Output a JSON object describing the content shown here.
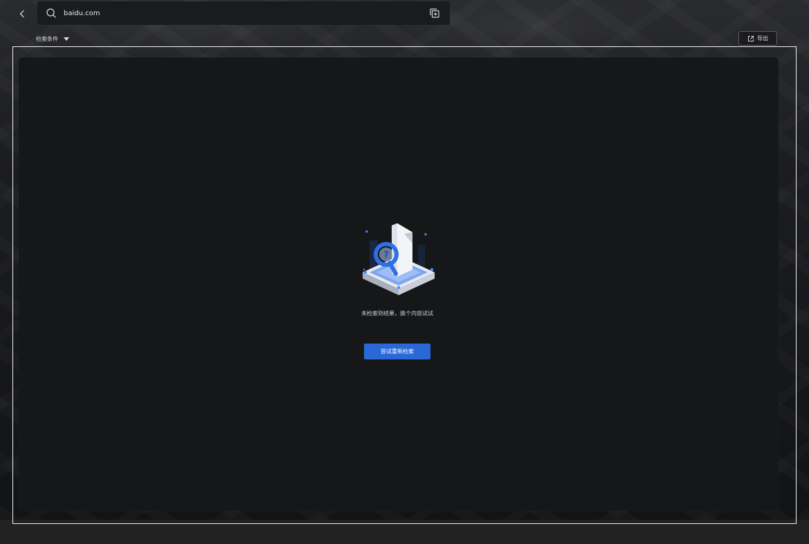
{
  "search": {
    "value": "baidu.com"
  },
  "filters": {
    "label": "检索条件"
  },
  "toolbar": {
    "export_label": "导出"
  },
  "empty_state": {
    "message": "未检索到结果，换个内容试试",
    "retry_label": "尝试重新检索"
  },
  "colors": {
    "accent": "#2a67d7",
    "panel": "#161719"
  },
  "icons": {
    "back": "chevron-left-icon",
    "search": "search-icon",
    "copy": "copy-add-icon",
    "filter_caret": "caret-down-icon",
    "export": "external-link-icon"
  }
}
